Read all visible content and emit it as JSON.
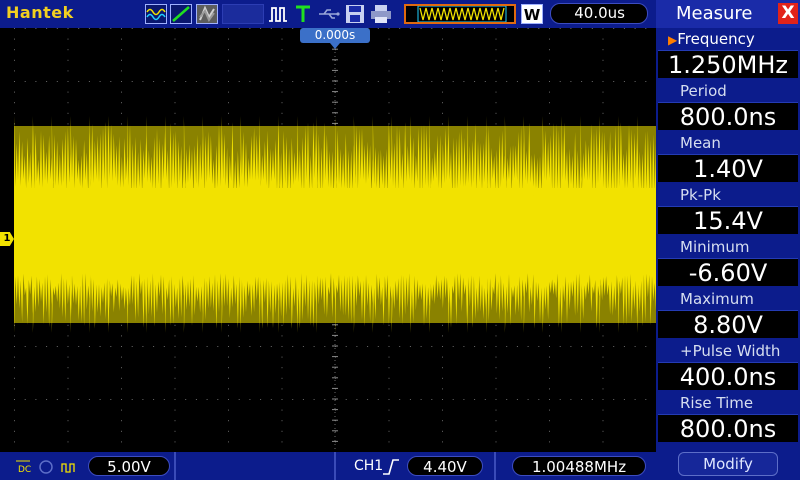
{
  "header": {
    "brand": "Hantek",
    "timebase": "40.0us",
    "icons": [
      "waveform-icon",
      "edge-icon",
      "persistence-icon",
      "blank-slot",
      "pulse-icon",
      "trigger-t-icon",
      "usb-icon",
      "save-icon",
      "print-icon",
      "memory-waveform-icon",
      "w-icon"
    ],
    "w_label": "W"
  },
  "screen": {
    "trigger_position": "0.000s",
    "channel_marker": "1"
  },
  "measure": {
    "title": "Measure",
    "close": "X",
    "items": [
      {
        "label": "Frequency",
        "value": "1.250MHz"
      },
      {
        "label": "Period",
        "value": "800.0ns"
      },
      {
        "label": "Mean",
        "value": "1.40V"
      },
      {
        "label": "Pk-Pk",
        "value": "15.4V"
      },
      {
        "label": "Minimum",
        "value": "-6.60V"
      },
      {
        "label": "Maximum",
        "value": "8.80V"
      },
      {
        "label": "+Pulse Width",
        "value": "400.0ns"
      },
      {
        "label": "Rise Time",
        "value": "800.0ns"
      }
    ],
    "modify": "Modify"
  },
  "footer": {
    "coupling": "DC",
    "ch1_scale": "5.00V",
    "trigger_source": "CH1",
    "trigger_level": "4.40V",
    "frequency": "1.00488MHz"
  },
  "colors": {
    "trace": "#f2e200",
    "trace_dark": "#8a8200",
    "ui_blue": "#0c1c8c",
    "accent_orange": "#ff7f00"
  }
}
